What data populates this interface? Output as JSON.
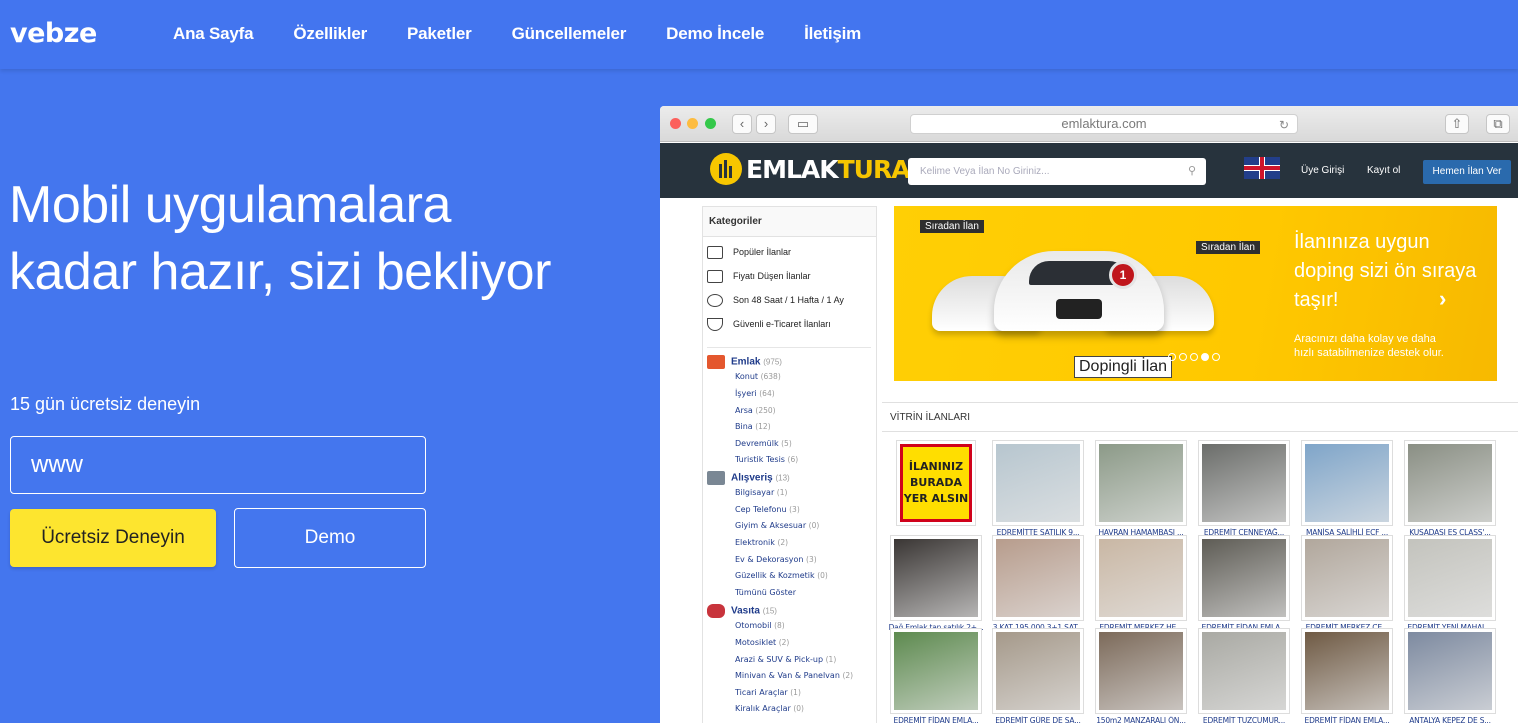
{
  "brand": {
    "name": "vebze"
  },
  "nav": {
    "items": [
      "Ana Sayfa",
      "Özellikler",
      "Paketler",
      "Güncellemeler",
      "Demo İncele",
      "İletişim"
    ]
  },
  "hero": {
    "title": "Mobil uygulamalara kadar hazır, sizi bekliyor",
    "subtitle": "15 gün ücretsiz deneyin",
    "domain_input": {
      "value": "www",
      "placeholder": ""
    },
    "trial_button": "Ücretsiz Deneyin",
    "demo_button": "Demo"
  },
  "preview": {
    "url": "emlaktura.com",
    "site": {
      "logo_part1": "EMLAK",
      "logo_part2": "TURA",
      "logo_reg": "®",
      "search_placeholder": "Kelime Veya İlan No Giriniz...",
      "member_login": "Üye Girişi",
      "register": "Kayıt ol",
      "post_ad": "Hemen İlan Ver",
      "sidebar": {
        "title": "Kategoriler",
        "quick": [
          "Popüler İlanlar",
          "Fiyatı Düşen İlanlar",
          "Son 48 Saat   / 1 Hafta / 1 Ay",
          "Güvenli e-Ticaret İlanları"
        ],
        "groups": [
          {
            "name": "Emlak",
            "count": "(975)",
            "items": [
              {
                "label": "Konut",
                "count": "(638)"
              },
              {
                "label": "İşyeri",
                "count": "(64)"
              },
              {
                "label": "Arsa",
                "count": "(250)"
              },
              {
                "label": "Bina",
                "count": "(12)"
              },
              {
                "label": "Devremülk",
                "count": "(5)"
              },
              {
                "label": "Turistik Tesis",
                "count": "(6)"
              }
            ]
          },
          {
            "name": "Alışveriş",
            "count": "(13)",
            "items": [
              {
                "label": "Bilgisayar",
                "count": "(1)"
              },
              {
                "label": "Cep Telefonu",
                "count": "(3)"
              },
              {
                "label": "Giyim & Aksesuar",
                "count": "(0)"
              },
              {
                "label": "Elektronik",
                "count": "(2)"
              },
              {
                "label": "Ev & Dekorasyon",
                "count": "(3)"
              },
              {
                "label": "Güzellik & Kozmetik",
                "count": "(0)"
              },
              {
                "label": "Tümünü Göster",
                "count": ""
              }
            ]
          },
          {
            "name": "Vasıta",
            "count": "(15)",
            "items": [
              {
                "label": "Otomobil",
                "count": "(8)"
              },
              {
                "label": "Motosiklet",
                "count": "(2)"
              },
              {
                "label": "Arazi & SUV & Pick-up",
                "count": "(1)"
              },
              {
                "label": "Minivan & Van & Panelvan",
                "count": "(2)"
              },
              {
                "label": "Ticari Araçlar",
                "count": "(1)"
              },
              {
                "label": "Kiralık Araçlar",
                "count": "(0)"
              }
            ]
          }
        ]
      },
      "banner": {
        "tag_left": "Sıradan İlan",
        "tag_right": "Sıradan İlan",
        "tag_bottom": "Dopingli İlan",
        "medal": "1",
        "headline": "İlanınıza uygun doping sizi ön sıraya taşır!",
        "text": "Aracınızı daha kolay ve daha hızlı satabilmenize destek olur.",
        "slides": 5,
        "active_slide": 4
      },
      "vitrin": {
        "title": "VİTRİN İLANLARI",
        "promo_text": "İLANINIZ BURADA YER ALSIN",
        "items": [
          {
            "caption": "",
            "color": "promo"
          },
          {
            "caption": "EDREMİTTE SATILIK 9...",
            "color": "#b7c6cf"
          },
          {
            "caption": "HAVRAN HAMAMBAŞI ...",
            "color": "#8c9a88"
          },
          {
            "caption": "EDREMİT CENNEYAĞ...",
            "color": "#6b6d6a"
          },
          {
            "caption": "MANİSA SALİHLİ ECF ...",
            "color": "#7fa5c9"
          },
          {
            "caption": "KUŞADASI ES CLASS'...",
            "color": "#8a8f84"
          },
          {
            "caption": "Dağ Emlak tan satılık 2+...",
            "color": "#3a3634"
          },
          {
            "caption": "3.KAT 195.000 3+1 SAT...",
            "color": "#b79c8c"
          },
          {
            "caption": "EDREMİT MERKEZ HE...",
            "color": "#c9b7a4"
          },
          {
            "caption": "EDREMİT FİDAN EMLA...",
            "color": "#5e5c55"
          },
          {
            "caption": "EDREMİT MERKEZ CE...",
            "color": "#b1a79c"
          },
          {
            "caption": "EDREMİT YENİ MAHAL...",
            "color": "#c3c3bd"
          },
          {
            "caption": "EDREMİT FİDAN EMLA...",
            "color": "#5d8a4f"
          },
          {
            "caption": "EDREMİT GÜRE DE SA...",
            "color": "#a5998a"
          },
          {
            "caption": "150m2 MANZARALI ÖN...",
            "color": "#7c6a5a"
          },
          {
            "caption": "EDREMİT TUZCUMUR...",
            "color": "#a9a9a3"
          },
          {
            "caption": "EDREMİT FİDAN EMLA...",
            "color": "#6f5a44"
          },
          {
            "caption": "ANTALYA KEPEZ DE S...",
            "color": "#7d8aa0"
          }
        ]
      }
    }
  },
  "colors": {
    "background": "#4476ee",
    "accent_yellow": "#fde52f",
    "site_header": "#27333d"
  }
}
